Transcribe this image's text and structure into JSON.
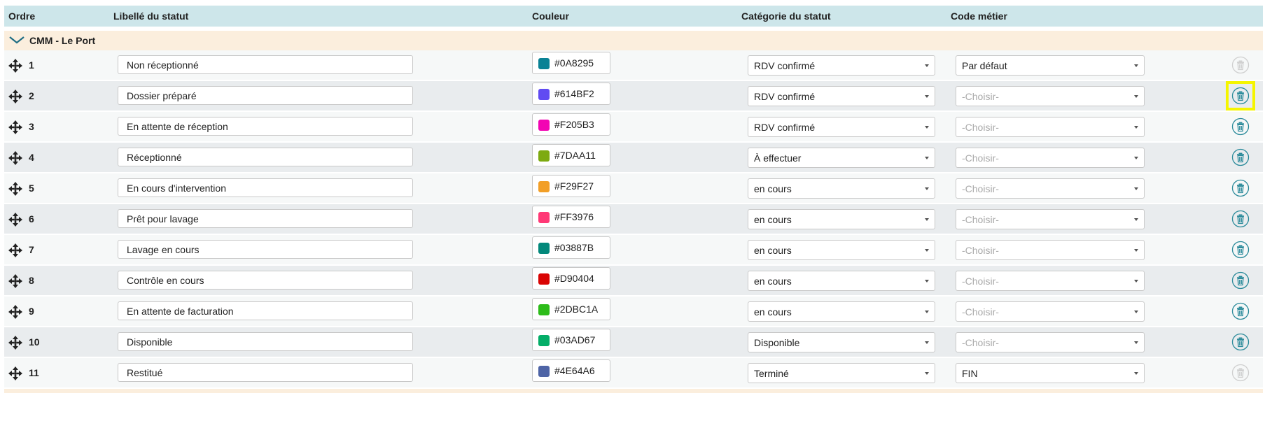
{
  "header": {
    "ordre": "Ordre",
    "libelle": "Libellé du statut",
    "couleur": "Couleur",
    "categorie": "Catégorie du statut",
    "code": "Code métier"
  },
  "group": {
    "name": "CMM - Le Port"
  },
  "rows": [
    {
      "ordre": "1",
      "libelle": "Non réceptionné",
      "color": "#0A8295",
      "hex": "#0A8295",
      "categorie": "RDV confirmé",
      "code": "Par défaut",
      "code_placeholder": false,
      "delete_enabled": false
    },
    {
      "ordre": "2",
      "libelle": "Dossier préparé",
      "color": "#614BF2",
      "hex": "#614BF2",
      "categorie": "RDV confirmé",
      "code": "-Choisir-",
      "code_placeholder": true,
      "delete_enabled": true,
      "highlighted": true
    },
    {
      "ordre": "3",
      "libelle": "En attente de réception",
      "color": "#F205B3",
      "hex": "#F205B3",
      "categorie": "RDV confirmé",
      "code": "-Choisir-",
      "code_placeholder": true,
      "delete_enabled": true
    },
    {
      "ordre": "4",
      "libelle": "Réceptionné",
      "color": "#7DAA11",
      "hex": "#7DAA11",
      "categorie": "À effectuer",
      "code": "-Choisir-",
      "code_placeholder": true,
      "delete_enabled": true
    },
    {
      "ordre": "5",
      "libelle": "En cours d'intervention",
      "color": "#F29F27",
      "hex": "#F29F27",
      "categorie": "en cours",
      "code": "-Choisir-",
      "code_placeholder": true,
      "delete_enabled": true
    },
    {
      "ordre": "6",
      "libelle": "Prêt pour lavage",
      "color": "#FF3976",
      "hex": "#FF3976",
      "categorie": "en cours",
      "code": "-Choisir-",
      "code_placeholder": true,
      "delete_enabled": true
    },
    {
      "ordre": "7",
      "libelle": "Lavage en cours",
      "color": "#03887B",
      "hex": "#03887B",
      "categorie": "en cours",
      "code": "-Choisir-",
      "code_placeholder": true,
      "delete_enabled": true
    },
    {
      "ordre": "8",
      "libelle": "Contrôle en cours",
      "color": "#D90404",
      "hex": "#D90404",
      "categorie": "en cours",
      "code": "-Choisir-",
      "code_placeholder": true,
      "delete_enabled": true
    },
    {
      "ordre": "9",
      "libelle": "En attente de facturation",
      "color": "#2DBC1A",
      "hex": "#2DBC1A",
      "categorie": "en cours",
      "code": "-Choisir-",
      "code_placeholder": true,
      "delete_enabled": true
    },
    {
      "ordre": "10",
      "libelle": "Disponible",
      "color": "#03AD67",
      "hex": "#03AD67",
      "categorie": "Disponible",
      "code": "-Choisir-",
      "code_placeholder": true,
      "delete_enabled": true
    },
    {
      "ordre": "11",
      "libelle": "Restitué",
      "color": "#4E64A6",
      "hex": "#4E64A6",
      "categorie": "Terminé",
      "code": "FIN",
      "code_placeholder": false,
      "delete_enabled": false
    }
  ],
  "icons": {
    "drag": "move-arrows-icon",
    "delete": "trash-icon",
    "expand": "chevron-down-icon"
  },
  "colors": {
    "header_bg": "#cde6ea",
    "group_bg": "#fbeedd",
    "trash_active": "#2a8a9a",
    "trash_disabled": "#cfcfcf",
    "highlight": "#f5f500"
  }
}
